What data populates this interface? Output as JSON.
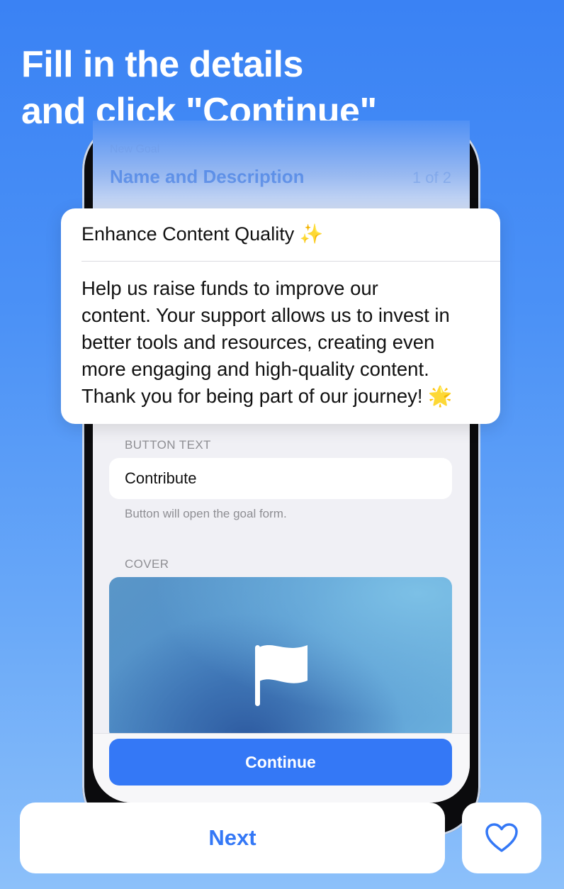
{
  "headline": {
    "line1": "Fill in the details",
    "line2": "and click \"Continue\""
  },
  "form": {
    "caption": "New Goal",
    "title": "Name and Description",
    "step": "1 of 2",
    "button_text_label": "BUTTON TEXT",
    "button_text_value": "Contribute",
    "button_text_hint": "Button will open the goal form.",
    "cover_label": "COVER",
    "cover_icon": "flag-icon",
    "continue_label": "Continue"
  },
  "popup": {
    "title": "Enhance Content Quality",
    "title_emoji": "✨",
    "body_lines": [
      "Help us raise funds to improve our",
      "content. Your support allows us to invest in",
      "better tools and resources, creating even",
      "more engaging and high-quality content.",
      "Thank you for being part of our journey!"
    ],
    "body_emoji": "🌟"
  },
  "footer": {
    "next_label": "Next",
    "favorite_icon": "heart-icon"
  },
  "colors": {
    "accent": "#3478f6",
    "background_top": "#3a82f4",
    "background_bottom": "#8cc0fa"
  }
}
